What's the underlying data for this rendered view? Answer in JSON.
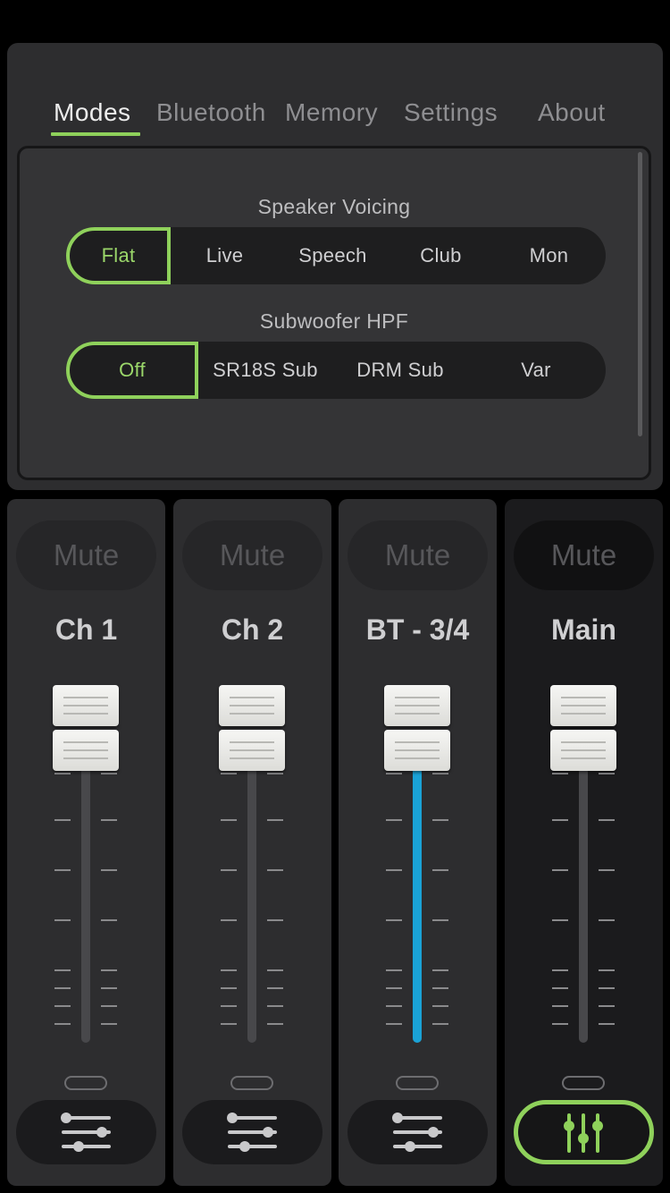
{
  "tabs": [
    "Modes",
    "Bluetooth",
    "Memory",
    "Settings",
    "About"
  ],
  "active_tab": "Modes",
  "modes": {
    "speaker_voicing": {
      "title": "Speaker Voicing",
      "options": [
        "Flat",
        "Live",
        "Speech",
        "Club",
        "Mon"
      ],
      "selected": "Flat"
    },
    "subwoofer_hpf": {
      "title": "Subwoofer HPF",
      "options": [
        "Off",
        "SR18S Sub",
        "DRM Sub",
        "Var"
      ],
      "selected": "Off"
    }
  },
  "channels": [
    {
      "name": "Ch 1",
      "mute_label": "Mute",
      "level": 1.0,
      "eq_active": false
    },
    {
      "name": "Ch 2",
      "mute_label": "Mute",
      "level": 1.0,
      "eq_active": false
    },
    {
      "name": "BT - 3/4",
      "mute_label": "Mute",
      "level": 1.0,
      "eq_active": false,
      "fill_color": "#1aa2d6"
    },
    {
      "name": "Main",
      "mute_label": "Mute",
      "level": 1.0,
      "eq_active": true
    }
  ],
  "colors": {
    "accent": "#8fd15b",
    "bt_fill": "#1aa2d6"
  }
}
